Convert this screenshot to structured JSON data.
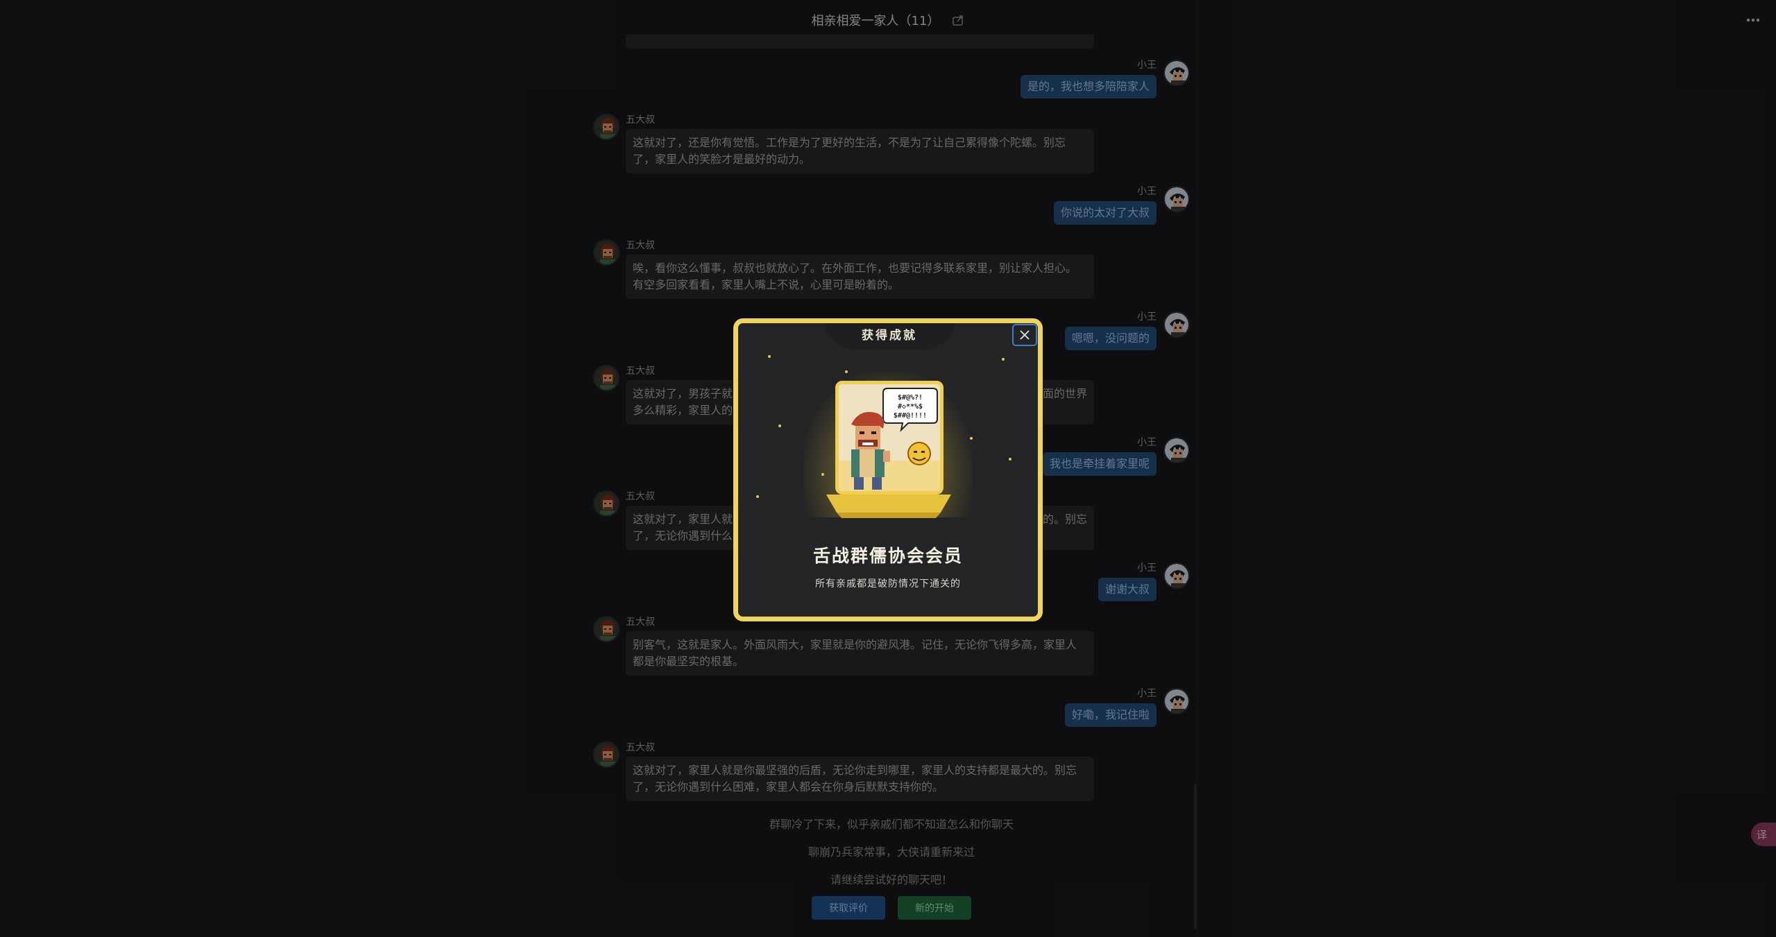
{
  "header": {
    "title": "相亲相爱一家人（11）"
  },
  "chat": {
    "messages": [
      {
        "side": "right",
        "sender": "小王",
        "text": "是的，我也想多陪陪家人"
      },
      {
        "side": "left",
        "sender": "五大叔",
        "line1": "这就对了，还是你有觉悟。工作是为了更好的生活，不是为了让自己累得像个陀螺。别忘",
        "line2": "了，家里人的笑脸才是最好的动力。"
      },
      {
        "side": "right",
        "sender": "小王",
        "text": "你说的太对了大叔"
      },
      {
        "side": "left",
        "sender": "五大叔",
        "line1": "唉，看你这么懂事，叔叔也就放心了。在外面工作，也要记得多联系家里，别让家人担心。",
        "line2": "有空多回家看看，家里人嘴上不说，心里可是盼着的。"
      },
      {
        "side": "right",
        "sender": "小王",
        "text": "嗯嗯，没问题的"
      },
      {
        "side": "left",
        "sender": "五大叔",
        "line1": "这就对了，男孩子就",
        "line1b": "面的世界",
        "line2": "多么精彩，家里人的"
      },
      {
        "side": "right",
        "sender": "小王",
        "text": "我也是牵挂着家里呢"
      },
      {
        "side": "left",
        "sender": "五大叔",
        "line1": "这就对了，家里人就",
        "line1b": "的。别忘",
        "line2": "了，无论你遇到什么"
      },
      {
        "side": "right",
        "sender": "小王",
        "text": "谢谢大叔"
      },
      {
        "side": "left",
        "sender": "五大叔",
        "line1": "别客气，这就是家人。外面风雨大，家里就是你的避风港。记住，无论你飞得多高，家里人",
        "line2": "都是你最坚实的根基。"
      },
      {
        "side": "right",
        "sender": "小王",
        "text": "好嘞，我记住啦"
      },
      {
        "side": "left",
        "sender": "五大叔",
        "line1": "这就对了，家里人就是你最坚强的后盾，无论你走到哪里，家里人的支持都是最大的。别忘",
        "line2": "了，无论你遇到什么困难，家里人都会在你身后默默支持你的。"
      }
    ],
    "system": [
      "群聊冷了下来，似乎亲戚们都不知道怎么和你聊天",
      "聊崩乃兵家常事，大侠请重新来过",
      "请继续尝试好的聊天吧！"
    ],
    "buttons": {
      "evaluate": "获取评价",
      "restart": "新的开始"
    }
  },
  "floating": {
    "label": "译"
  },
  "modal": {
    "tab": "获得成就",
    "badge_bubble": "$#@%?!\n#◇**%$\n$##@!!!!",
    "title": "舌战群儒协会会员",
    "description": "所有亲戚都是破防情况下通关的"
  },
  "colors": {
    "accent_gold": "#f1d45a",
    "bubble_blue": "#244d7a",
    "button_blue": "#214f8c",
    "button_green": "#1f6a3d"
  }
}
